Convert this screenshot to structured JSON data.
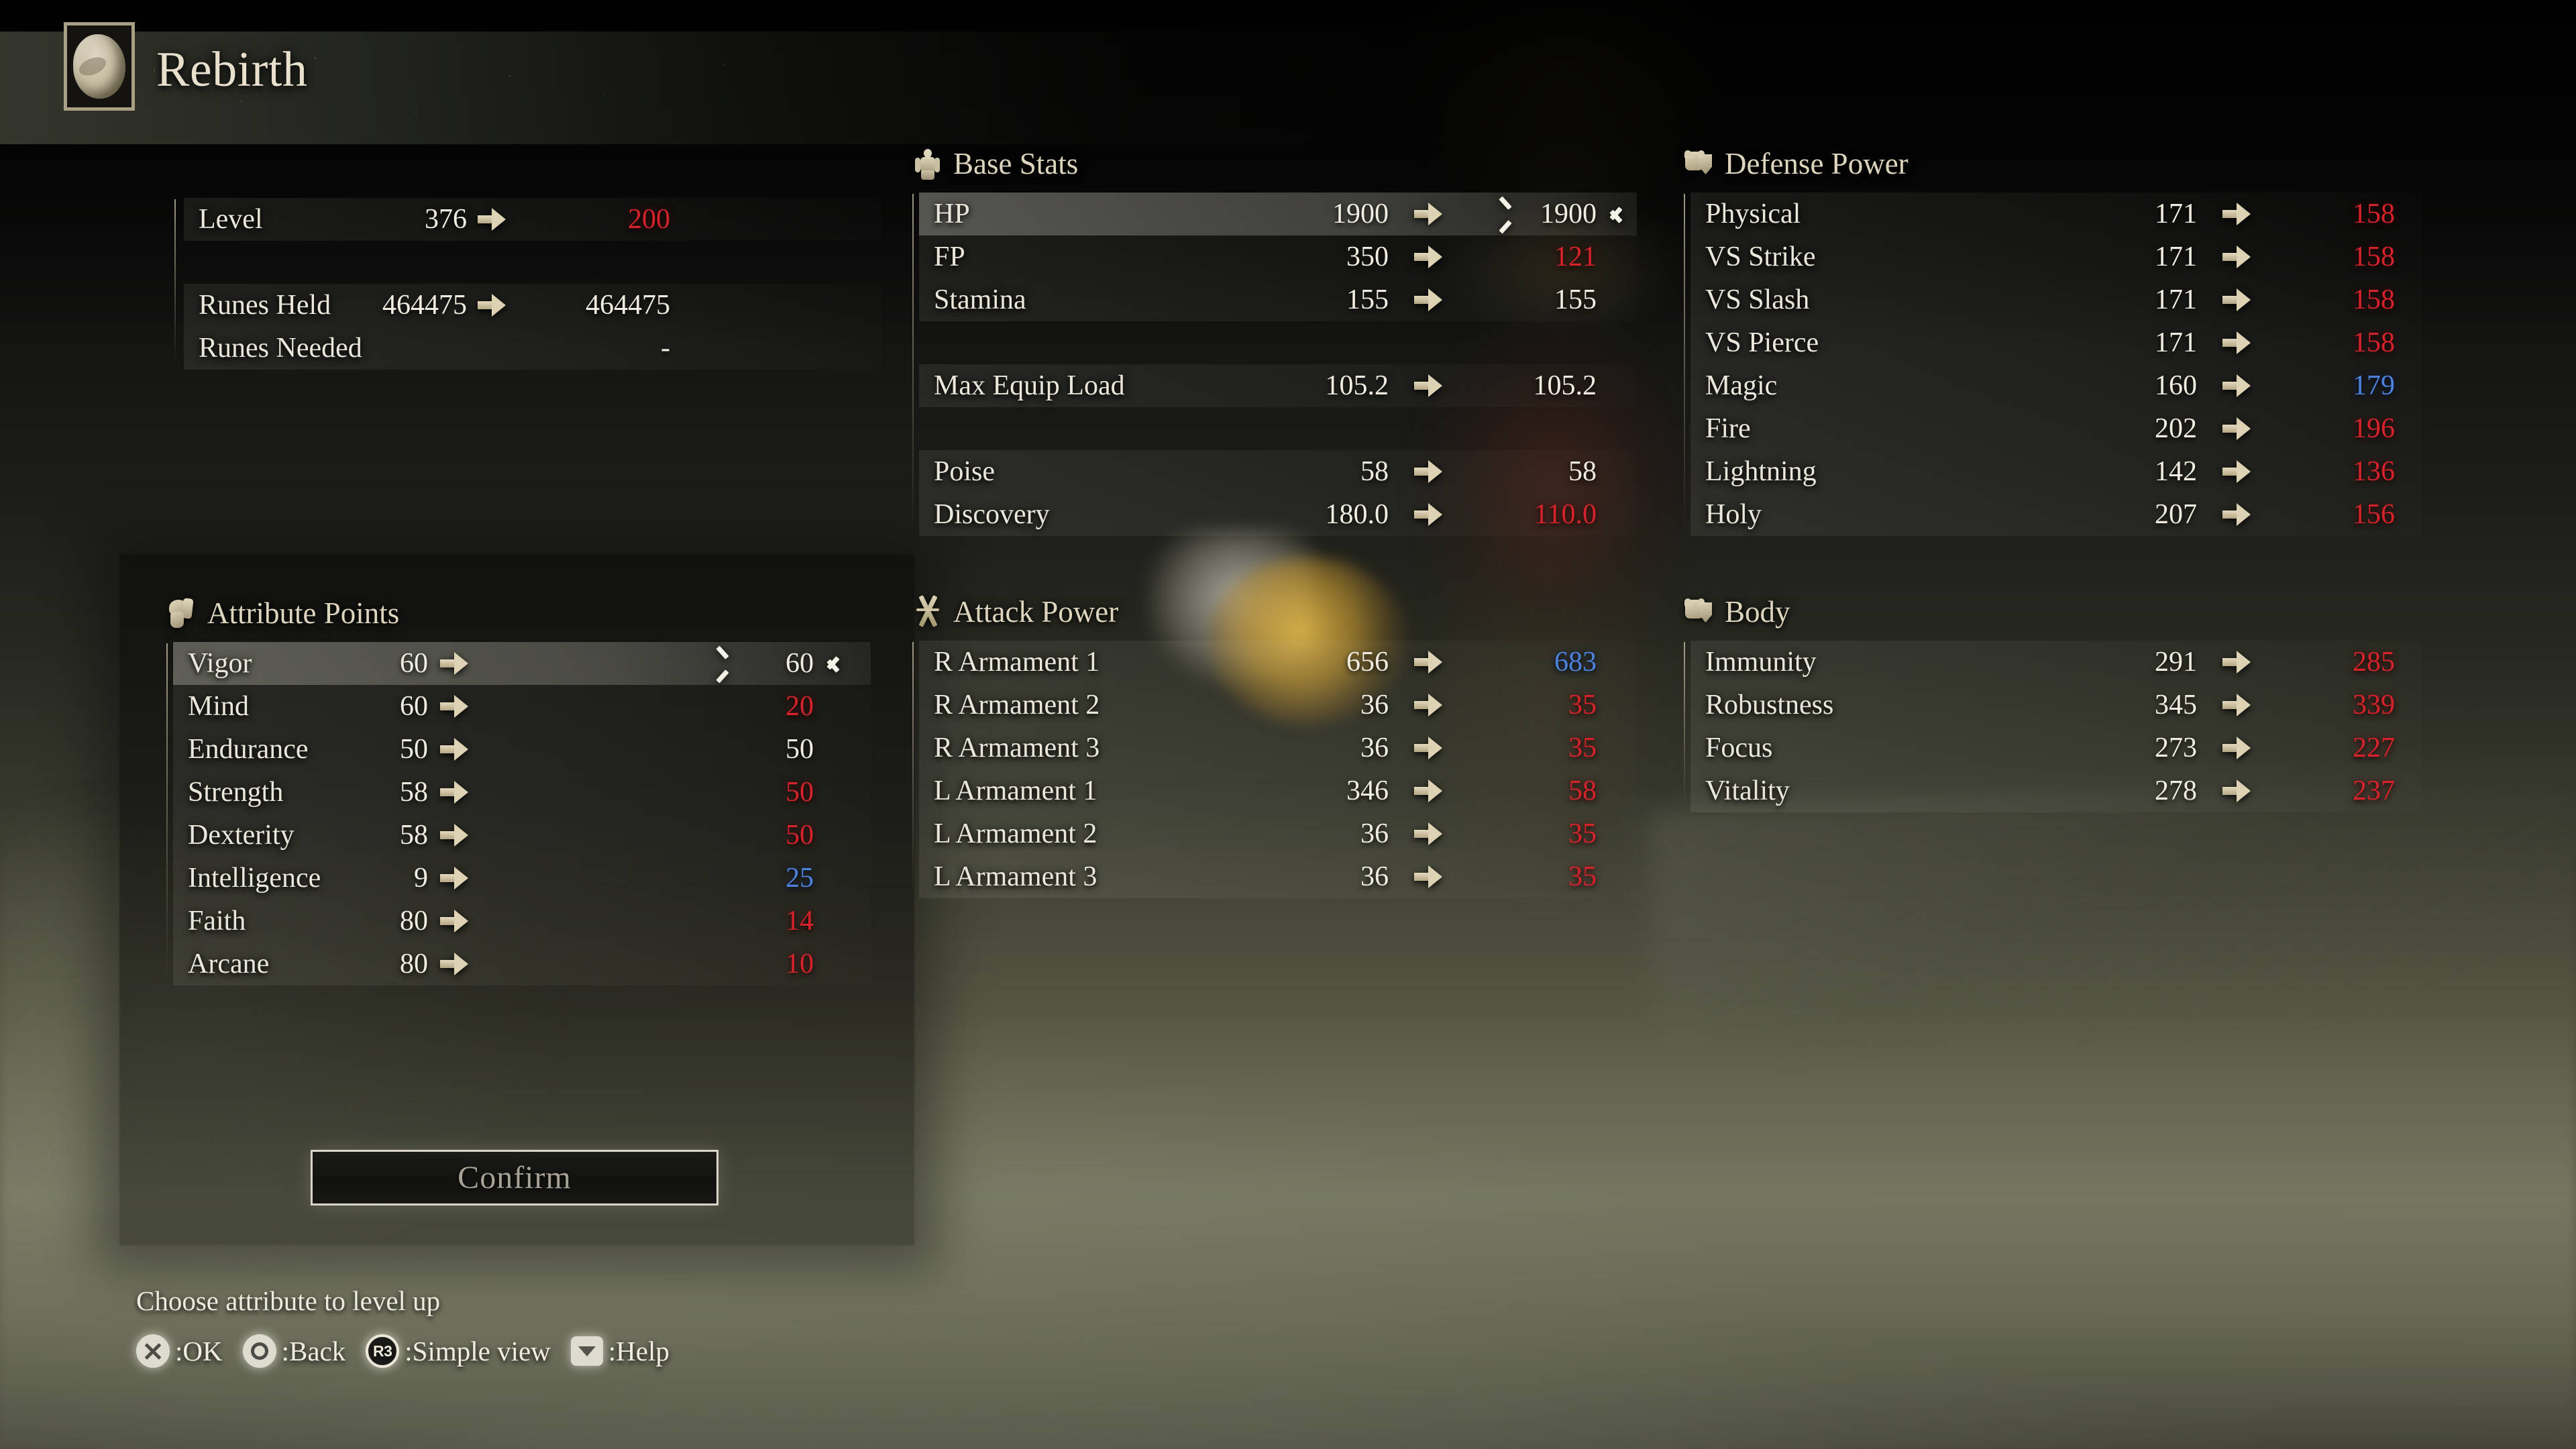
{
  "header": {
    "title": "Rebirth",
    "icon": "embryo-icon"
  },
  "level_summary": {
    "rows": [
      {
        "label": "Level",
        "old": "376",
        "new": "200",
        "dir": "down",
        "arrow": true,
        "gap": false
      },
      {
        "label": "Runes Held",
        "old": "464475",
        "new": "464475",
        "dir": "same",
        "arrow": true,
        "gap": true
      },
      {
        "label": "Runes Needed",
        "old": "",
        "new": "-",
        "dir": "same",
        "arrow": false,
        "gap": false
      }
    ]
  },
  "attribute_points": {
    "title": "Attribute Points",
    "icon": "bicep-icon",
    "selected_index": 0,
    "rows": [
      {
        "label": "Vigor",
        "old": "60",
        "new": "60",
        "dir": "same"
      },
      {
        "label": "Mind",
        "old": "60",
        "new": "20",
        "dir": "down"
      },
      {
        "label": "Endurance",
        "old": "50",
        "new": "50",
        "dir": "same"
      },
      {
        "label": "Strength",
        "old": "58",
        "new": "50",
        "dir": "down"
      },
      {
        "label": "Dexterity",
        "old": "58",
        "new": "50",
        "dir": "down"
      },
      {
        "label": "Intelligence",
        "old": "9",
        "new": "25",
        "dir": "up"
      },
      {
        "label": "Faith",
        "old": "80",
        "new": "14",
        "dir": "down"
      },
      {
        "label": "Arcane",
        "old": "80",
        "new": "10",
        "dir": "down"
      }
    ],
    "confirm_label": "Confirm"
  },
  "base_stats": {
    "title": "Base Stats",
    "icon": "body-figure-icon",
    "selected_index": 0,
    "rows": [
      {
        "label": "HP",
        "old": "1900",
        "new": "1900",
        "dir": "same",
        "gap": "none"
      },
      {
        "label": "FP",
        "old": "350",
        "new": "121",
        "dir": "down",
        "gap": "none"
      },
      {
        "label": "Stamina",
        "old": "155",
        "new": "155",
        "dir": "same",
        "gap": "none"
      },
      {
        "label": "Max Equip Load",
        "old": "105.2",
        "new": "105.2",
        "dir": "same",
        "gap": "full"
      },
      {
        "label": "Poise",
        "old": "58",
        "new": "58",
        "dir": "same",
        "gap": "full"
      },
      {
        "label": "Discovery",
        "old": "180.0",
        "new": "110.0",
        "dir": "down",
        "gap": "none"
      }
    ]
  },
  "attack_power": {
    "title": "Attack Power",
    "icon": "crossed-swords-icon",
    "rows": [
      {
        "label": "R Armament 1",
        "old": "656",
        "new": "683",
        "dir": "up"
      },
      {
        "label": "R Armament 2",
        "old": "36",
        "new": "35",
        "dir": "down"
      },
      {
        "label": "R Armament 3",
        "old": "36",
        "new": "35",
        "dir": "down"
      },
      {
        "label": "L Armament 1",
        "old": "346",
        "new": "58",
        "dir": "down"
      },
      {
        "label": "L Armament 2",
        "old": "36",
        "new": "35",
        "dir": "down"
      },
      {
        "label": "L Armament 3",
        "old": "36",
        "new": "35",
        "dir": "down"
      }
    ]
  },
  "defense_power": {
    "title": "Defense Power",
    "icon": "armor-shield-icon",
    "rows": [
      {
        "label": "Physical",
        "old": "171",
        "new": "158",
        "dir": "down"
      },
      {
        "label": "VS Strike",
        "old": "171",
        "new": "158",
        "dir": "down"
      },
      {
        "label": "VS Slash",
        "old": "171",
        "new": "158",
        "dir": "down"
      },
      {
        "label": "VS Pierce",
        "old": "171",
        "new": "158",
        "dir": "down"
      },
      {
        "label": "Magic",
        "old": "160",
        "new": "179",
        "dir": "up"
      },
      {
        "label": "Fire",
        "old": "202",
        "new": "196",
        "dir": "down"
      },
      {
        "label": "Lightning",
        "old": "142",
        "new": "136",
        "dir": "down"
      },
      {
        "label": "Holy",
        "old": "207",
        "new": "156",
        "dir": "down"
      }
    ]
  },
  "body": {
    "title": "Body",
    "icon": "armor-shield-icon",
    "rows": [
      {
        "label": "Immunity",
        "old": "291",
        "new": "285",
        "dir": "down"
      },
      {
        "label": "Robustness",
        "old": "345",
        "new": "339",
        "dir": "down"
      },
      {
        "label": "Focus",
        "old": "273",
        "new": "227",
        "dir": "down"
      },
      {
        "label": "Vitality",
        "old": "278",
        "new": "237",
        "dir": "down"
      }
    ]
  },
  "footer": {
    "hint": "Choose attribute to level up",
    "prompts": [
      {
        "glyph": "cross",
        "label": ":OK"
      },
      {
        "glyph": "circle",
        "label": ":Back"
      },
      {
        "glyph": "r3",
        "glyph_text": "R3",
        "label": ":Simple view"
      },
      {
        "glyph": "dpad",
        "label": ":Help"
      }
    ]
  },
  "colors": {
    "decrease": "#d4232b",
    "increase": "#4d82dc",
    "neutral": "#f0ece1",
    "accent": "#ddd4bd"
  }
}
